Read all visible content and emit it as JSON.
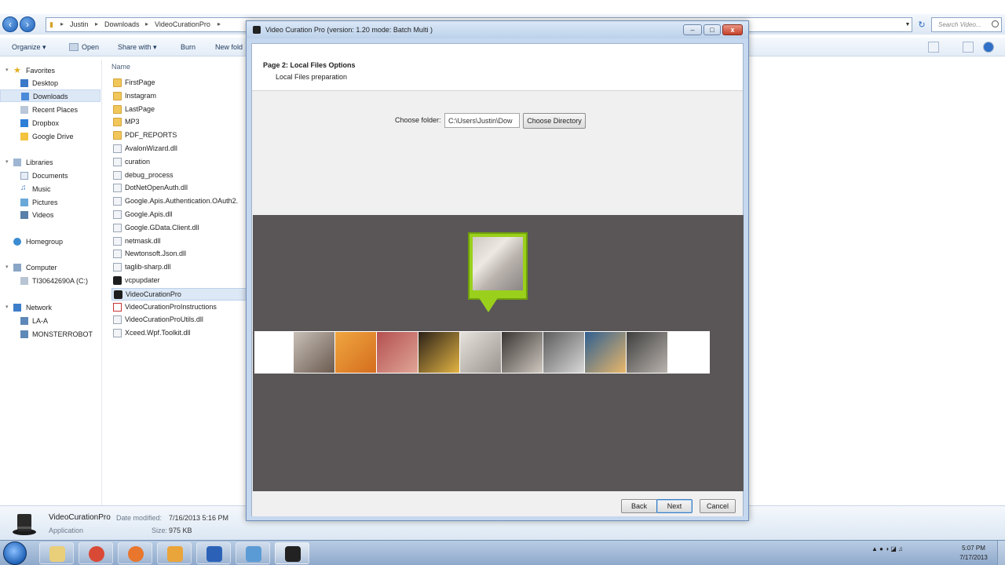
{
  "explorer": {
    "breadcrumb": [
      "Justin",
      "Downloads",
      "VideoCurationPro"
    ],
    "search_placeholder": "Search Video...",
    "toolbar": {
      "organize": "Organize ▾",
      "open": "Open",
      "share_with": "Share with ▾",
      "burn": "Burn",
      "new_folder": "New fold"
    },
    "sidebar": {
      "favorites": "Favorites",
      "desktop": "Desktop",
      "downloads": "Downloads",
      "recent_places": "Recent Places",
      "dropbox": "Dropbox",
      "google_drive": "Google Drive",
      "libraries": "Libraries",
      "documents": "Documents",
      "music": "Music",
      "pictures": "Pictures",
      "videos": "Videos",
      "homegroup": "Homegroup",
      "computer": "Computer",
      "drive_c": "TI30642690A (C:)",
      "network": "Network",
      "la_a": "LA-A",
      "monsterrobot": "MONSTERROBOT"
    },
    "column_name": "Name",
    "files": [
      {
        "name": "FirstPage",
        "type": "folder"
      },
      {
        "name": "Instagram",
        "type": "folder"
      },
      {
        "name": "LastPage",
        "type": "folder"
      },
      {
        "name": "MP3",
        "type": "folder"
      },
      {
        "name": "PDF_REPORTS",
        "type": "folder"
      },
      {
        "name": "AvalonWizard.dll",
        "type": "dll"
      },
      {
        "name": "curation",
        "type": "dll"
      },
      {
        "name": "debug_process",
        "type": "dll"
      },
      {
        "name": "DotNetOpenAuth.dll",
        "type": "dll"
      },
      {
        "name": "Google.Apis.Authentication.OAuth2.",
        "type": "dll"
      },
      {
        "name": "Google.Apis.dll",
        "type": "dll"
      },
      {
        "name": "Google.GData.Client.dll",
        "type": "dll"
      },
      {
        "name": "netmask.dll",
        "type": "dll"
      },
      {
        "name": "Newtonsoft.Json.dll",
        "type": "dll"
      },
      {
        "name": "taglib-sharp.dll",
        "type": "dll"
      },
      {
        "name": "vcpupdater",
        "type": "app"
      },
      {
        "name": "VideoCurationPro",
        "type": "app"
      },
      {
        "name": "VideoCurationProInstructions",
        "type": "pdf"
      },
      {
        "name": "VideoCurationProUtils.dll",
        "type": "dll"
      },
      {
        "name": "Xceed.Wpf.Toolkit.dll",
        "type": "dll"
      }
    ],
    "details": {
      "name": "VideoCurationPro",
      "type": "Application",
      "date_modified_label": "Date modified:",
      "date_modified": "7/16/2013 5:16 PM",
      "size_label": "Size:",
      "size": "975 KB"
    }
  },
  "app": {
    "title": "Video Curation Pro (version: 1.20 mode: Batch Multi )",
    "page_title": "Page 2: Local Files Options",
    "page_subtitle": "Local Files preparation",
    "choose_folder_label": "Choose folder:",
    "folder_value": "C:\\Users\\Justin\\Dow",
    "choose_directory": "Choose Directory",
    "back": "Back",
    "next": "Next",
    "cancel": "Cancel",
    "win_min": "–",
    "win_max": "□",
    "win_close": "x"
  },
  "thumbnails": [
    {
      "colors": [
        "#c7bfb7",
        "#6b5a4f"
      ]
    },
    {
      "colors": [
        "#f0a640",
        "#d46d1e"
      ]
    },
    {
      "colors": [
        "#b45050",
        "#e0a596"
      ]
    },
    {
      "colors": [
        "#2b2118",
        "#e3b443"
      ]
    },
    {
      "colors": [
        "#e6e2dc",
        "#9b9590"
      ]
    },
    {
      "colors": [
        "#3a3533",
        "#cfc8c0"
      ]
    },
    {
      "colors": [
        "#5c5c5c",
        "#d8d8d8"
      ]
    },
    {
      "colors": [
        "#2f5f91",
        "#e9b76a"
      ]
    },
    {
      "colors": [
        "#3e3e3e",
        "#b9b3ad"
      ]
    }
  ],
  "taskbar": {
    "clock_time": "5:07 PM",
    "clock_date": "7/17/2013",
    "apps": [
      "explorer-icon",
      "chrome-icon",
      "firefox-icon",
      "outlook-icon",
      "network-icon",
      "remote-desktop-icon",
      "video-curation-pro-icon"
    ]
  }
}
